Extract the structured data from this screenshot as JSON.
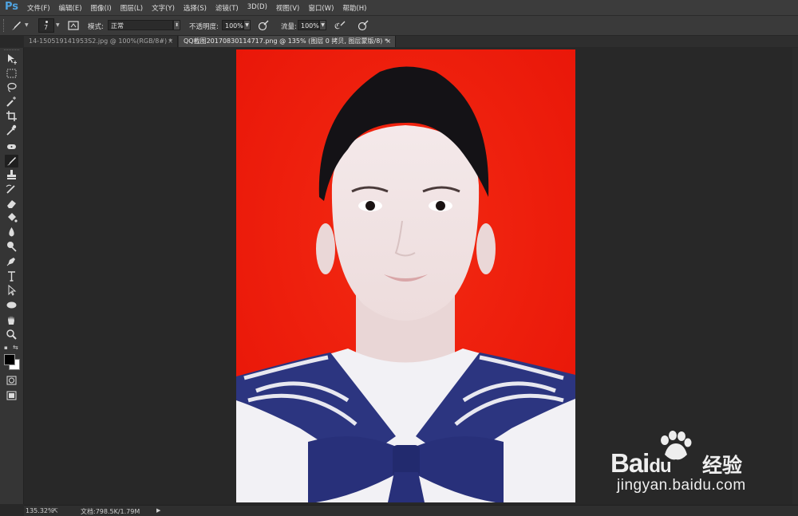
{
  "app": {
    "logo": "Ps"
  },
  "menu": [
    "文件(F)",
    "编辑(E)",
    "图像(I)",
    "图层(L)",
    "文字(Y)",
    "选择(S)",
    "滤镜(T)",
    "3D(D)",
    "视图(V)",
    "窗口(W)",
    "帮助(H)"
  ],
  "options": {
    "brush_size": "7",
    "mode_label": "模式:",
    "mode_value": "正常",
    "opacity_label": "不透明度:",
    "opacity_value": "100%",
    "flow_label": "流量:",
    "flow_value": "100%",
    "icons": [
      "brush-tool-icon",
      "brush-preset-icon",
      "brush-panel-toggle-icon",
      "pressure-opacity-icon",
      "airbrush-icon",
      "pressure-size-icon"
    ]
  },
  "tabs": [
    {
      "label": "14-150519141953S2.jpg @ 100%(RGB/8#) *",
      "active": false
    },
    {
      "label": "QQ截图20170830114717.png @ 135% (图层 0 拷贝, 图层蒙版/8) *",
      "active": true
    }
  ],
  "tools": [
    "move",
    "marquee",
    "lasso",
    "magic-wand",
    "crop",
    "eyedropper",
    "spot-healing",
    "brush",
    "clone-stamp",
    "history-brush",
    "eraser",
    "paint-bucket",
    "blur",
    "dodge",
    "pen",
    "type",
    "path-selection",
    "ellipse",
    "hand",
    "zoom"
  ],
  "colors": {
    "foreground": "#000000",
    "background": "#ffffff",
    "canvas_bg": "#f01a0c",
    "uniform": "#2c3580"
  },
  "status": {
    "zoom": "135.32%",
    "doc_label": "文档:798.5K/1.79M"
  },
  "watermark": {
    "brand": "Bai",
    "brand_mid": "du",
    "brand_cn": "经验",
    "url": "jingyan.baidu.com"
  }
}
